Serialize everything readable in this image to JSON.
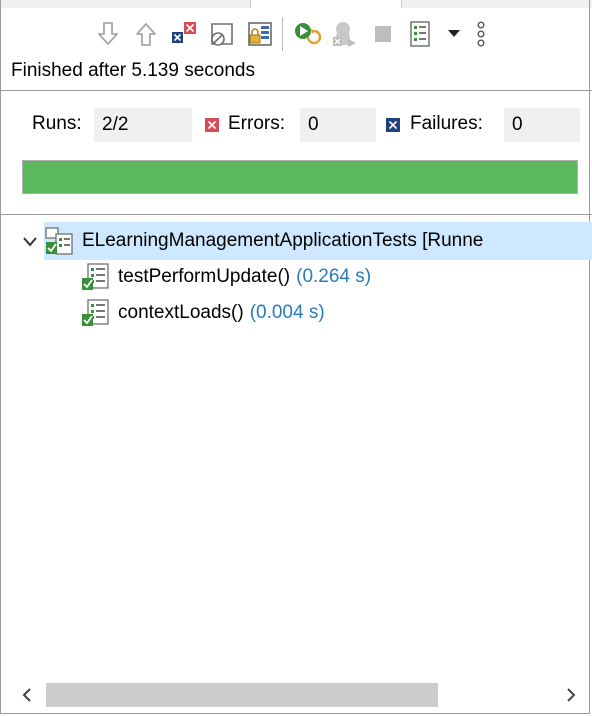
{
  "toolbar": {
    "buttons": [
      {
        "name": "next-failure-button",
        "icon": "arrow-down-icon"
      },
      {
        "name": "previous-failure-button",
        "icon": "arrow-up-icon"
      },
      {
        "name": "show-failures-only-button",
        "icon": "failures-filter-icon"
      },
      {
        "name": "show-skipped-button",
        "icon": "skipped-filter-icon"
      },
      {
        "name": "scroll-lock-button",
        "icon": "lock-icon"
      },
      {
        "name": "rerun-test-button",
        "icon": "rerun-icon"
      },
      {
        "name": "rerun-failed-first-button",
        "icon": "rerun-failed-icon"
      },
      {
        "name": "stop-button",
        "icon": "stop-icon"
      },
      {
        "name": "test-run-history-button",
        "icon": "history-icon"
      },
      {
        "name": "view-menu-button",
        "icon": "dropdown-triangle-icon"
      },
      {
        "name": "more-options-button",
        "icon": "vertical-dots-icon"
      }
    ]
  },
  "status": {
    "message": "Finished after 5.139 seconds"
  },
  "counters": {
    "runs_label": "Runs:",
    "runs_value": "2/2",
    "errors_label": "Errors:",
    "errors_value": "0",
    "failures_label": "Failures:",
    "failures_value": "0"
  },
  "progress": {
    "fraction": 1.0,
    "color": "#5cb85c"
  },
  "tree": {
    "root": {
      "label": "ELearningManagementApplicationTests [Runne",
      "expanded": true,
      "icon": "test-suite-passed-icon"
    },
    "children": [
      {
        "label": "testPerformUpdate()",
        "time": "(0.264 s)",
        "icon": "test-passed-icon"
      },
      {
        "label": "contextLoads()",
        "time": "(0.004 s)",
        "icon": "test-passed-icon"
      }
    ]
  },
  "colors": {
    "selection": "#cde8ff",
    "time_text": "#2b7bb9",
    "error_badge": "#d94a55",
    "failure_badge": "#22407a"
  }
}
